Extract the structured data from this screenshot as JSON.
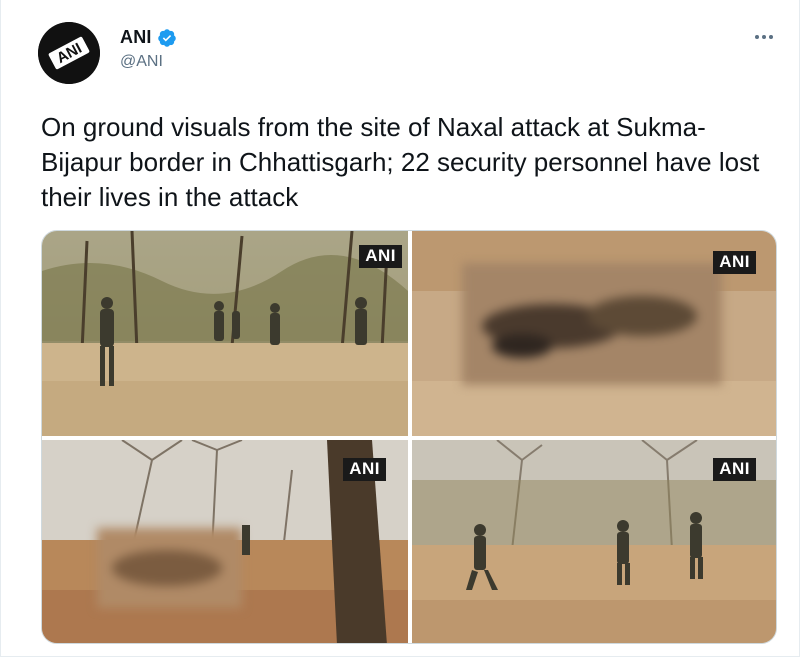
{
  "tweet": {
    "display_name": "ANI",
    "handle": "@ANI",
    "verified_icon": "verified-badge-icon",
    "text": "On ground visuals from the site of Naxal attack at Sukma-Bijapur border in Chhattisgarh; 22 security personnel have lost their lives in the attack",
    "more_icon": "more-options-icon"
  },
  "avatar": {
    "logo_text": "ANI"
  },
  "media": {
    "photos": [
      {
        "watermark": "ANI",
        "blurred": false
      },
      {
        "watermark": "ANI",
        "blurred": true
      },
      {
        "watermark": "ANI",
        "blurred": true
      },
      {
        "watermark": "ANI",
        "blurred": false
      }
    ]
  },
  "colors": {
    "accent": "#1d9bf0",
    "secondary_text": "#5b7083",
    "border": "#cfd9de"
  }
}
